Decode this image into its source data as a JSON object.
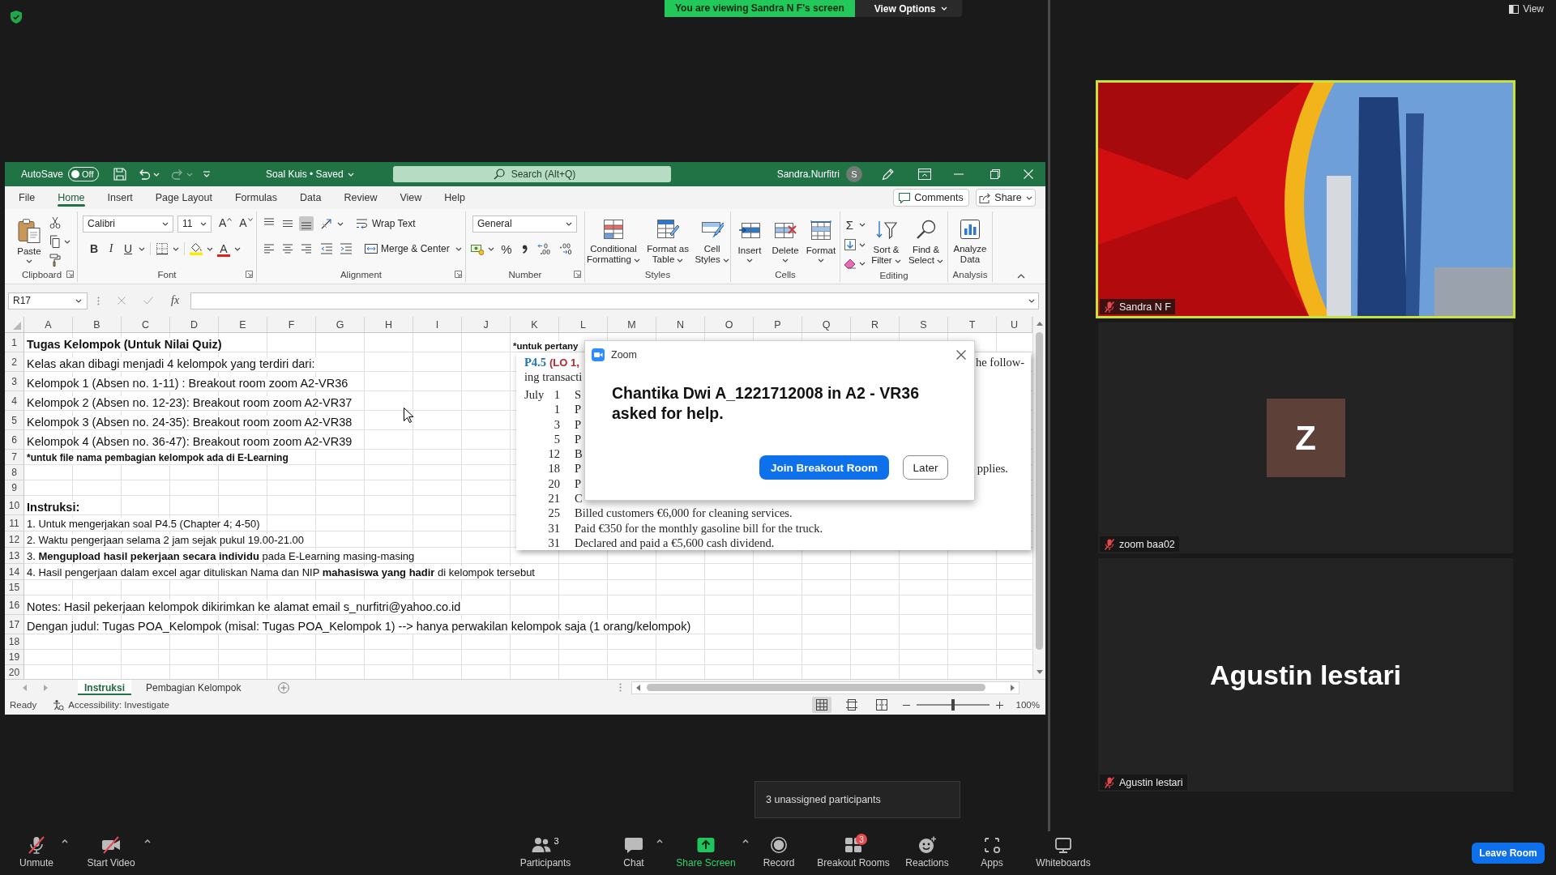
{
  "top_bar": {
    "viewing_banner": "You are viewing Sandra N F's screen",
    "view_options": "View Options"
  },
  "excel": {
    "title_bar": {
      "autosave": "AutoSave",
      "autosave_on": false,
      "autosave_state": "Off",
      "quick_access": [
        {
          "kind": "save",
          "disabled": false
        },
        {
          "kind": "undo",
          "disabled": false
        },
        {
          "kind": "redo",
          "disabled": true
        }
      ],
      "document": "Soal Kuis • Saved",
      "search": {
        "placeholder": "Search (Alt+Q)"
      },
      "user_name": "Sandra.Nurfitri",
      "user_initial": "S"
    },
    "tabs": [
      {
        "label": "File",
        "selected": false
      },
      {
        "label": "Home",
        "selected": true
      },
      {
        "label": "Insert",
        "selected": false
      },
      {
        "label": "Page Layout",
        "selected": false
      },
      {
        "label": "Formulas",
        "selected": false
      },
      {
        "label": "Data",
        "selected": false
      },
      {
        "label": "Review",
        "selected": false
      },
      {
        "label": "View",
        "selected": false
      },
      {
        "label": "Help",
        "selected": false
      }
    ],
    "comments_button": "Comments",
    "share_button": "Share",
    "ribbon": {
      "clipboard": {
        "label": "Clipboard",
        "paste": "Paste"
      },
      "font": {
        "label": "Font",
        "font_name": "Calibri",
        "font_size": "11",
        "grow_font": "A",
        "shrink_font": "A",
        "bold": "B",
        "italic": "I",
        "underline": "U",
        "font_color": "A"
      },
      "alignment": {
        "label": "Alignment",
        "vertical": [
          {
            "selected": false
          },
          {
            "selected": false
          },
          {
            "selected": true
          }
        ],
        "horizontal": [
          {
            "selected": false
          },
          {
            "selected": false
          },
          {
            "selected": false
          }
        ],
        "wrap_text": "Wrap Text",
        "merge_center": "Merge & Center"
      },
      "number": {
        "label": "Number",
        "format": "General",
        "percent": "%"
      },
      "styles": {
        "label": "Styles",
        "buttons": [
          "Conditional Formatting",
          "Format as Table",
          "Cell Styles"
        ]
      },
      "cells": {
        "label": "Cells",
        "buttons": [
          "Insert",
          "Delete",
          "Format"
        ]
      },
      "editing": {
        "label": "Editing",
        "autosum": "Σ",
        "buttons": [
          "Sort & Filter",
          "Find & Select"
        ]
      },
      "analysis": {
        "label": "Analysis",
        "buttons": [
          "Analyze Data"
        ]
      }
    },
    "formula_bar": {
      "name_box": "R17",
      "function_label": "fx"
    },
    "columns": [
      "A",
      "B",
      "C",
      "D",
      "E",
      "F",
      "G",
      "H",
      "I",
      "J",
      "K",
      "L",
      "M",
      "N",
      "O",
      "P",
      "Q",
      "R",
      "S",
      "T",
      "U"
    ],
    "rows": [
      {
        "number": "1",
        "kind": "title",
        "cell_a": "Tugas Kelompok (Untuk Nilai Quiz)",
        "cell_k": "*untuk pertany"
      },
      {
        "number": "2",
        "kind": "large",
        "cell_a": "Kelas akan dibagi menjadi 4 kelompok yang terdiri dari:"
      },
      {
        "number": "3",
        "kind": "large",
        "cell_a": "Kelompok 1 (Absen no. 1-11) : Breakout room zoom A2-VR36"
      },
      {
        "number": "4",
        "kind": "large",
        "cell_a": "Kelompok 2 (Absen no. 12-23): Breakout room zoom A2-VR37"
      },
      {
        "number": "5",
        "kind": "large",
        "cell_a": "Kelompok 3 (Absen no. 24-35): Breakout room zoom A2-VR38"
      },
      {
        "number": "6",
        "kind": "large",
        "cell_a": "Kelompok 4 (Absen no. 36-47): Breakout room zoom A2-VR39"
      },
      {
        "number": "7",
        "kind": "note",
        "cell_a": "*untuk file nama pembagian kelompok ada di E-Learning"
      },
      {
        "number": "8",
        "kind": "blank"
      },
      {
        "number": "9",
        "kind": "blank"
      },
      {
        "number": "10",
        "kind": "title",
        "cell_a": "Instruksi:"
      },
      {
        "number": "11",
        "kind": "item",
        "cell_a": "1. Untuk mengerjakan soal P4.5 (Chapter 4; 4-50)"
      },
      {
        "number": "12",
        "kind": "item",
        "cell_a": "2. Waktu pengerjaan selama 2 jam sejak pukul 19.00-21.00"
      },
      {
        "number": "13",
        "kind": "item",
        "cell_a": "3. **Mengupload hasil pekerjaan secara individu** pada E-Learning masing-masing"
      },
      {
        "number": "14",
        "kind": "item",
        "cell_a": "4. Hasil pengerjaan dalam excel agar dituliskan Nama dan NIP **mahasiswa yang hadir** di kelompok tersebut"
      },
      {
        "number": "15",
        "kind": "blank"
      },
      {
        "number": "16",
        "kind": "large",
        "cell_a": "Notes: Hasil pekerjaan kelompok dikirimkan ke alamat email s_nurfitri@yahoo.co.id"
      },
      {
        "number": "17",
        "kind": "large",
        "cell_a": "Dengan judul: Tugas POA_Kelompok (misal: Tugas POA_Kelompok 1) --> hanya perwakilan kelompok saja (1 orang/kelompok)"
      },
      {
        "number": "18",
        "kind": "blank"
      },
      {
        "number": "19",
        "kind": "blank"
      },
      {
        "number": "20",
        "kind": "blank"
      }
    ],
    "sheet_tabs": [
      {
        "label": "Instruksi",
        "selected": true
      },
      {
        "label": "Pembagian Kelompok",
        "selected": false
      }
    ],
    "status_bar": {
      "status": "Ready",
      "accessibility": "Accessibility: Investigate",
      "views": [
        {
          "selected": true
        },
        {
          "selected": false
        },
        {
          "selected": false
        }
      ],
      "zoom_slider": {
        "level": 0.5
      },
      "zoom": "100%"
    }
  },
  "pasted_image": {
    "problem": "P4.5",
    "objectives": "(LO 1,",
    "intro_end": "he follow-",
    "intro_line2": "ing transacti",
    "transactions": [
      {
        "month": "July",
        "day": "1",
        "text": "S"
      },
      {
        "day": "1",
        "text": "P"
      },
      {
        "day": "3",
        "text": "P"
      },
      {
        "day": "5",
        "text": "P"
      },
      {
        "day": "12",
        "text": "B"
      },
      {
        "day": "18",
        "text": "P",
        "tail": "pplies."
      },
      {
        "day": "20",
        "text": "P"
      },
      {
        "day": "21",
        "text": "C"
      },
      {
        "day": "25",
        "text": "Billed customers €6,000 for cleaning services."
      },
      {
        "day": "31",
        "text": "Paid €350 for the monthly gasoline bill for the truck."
      },
      {
        "day": "31",
        "text": "Declared and paid a €5,600 cash dividend."
      }
    ]
  },
  "dialog": {
    "app_name": "Zoom",
    "message": "Chantika Dwi A_1221712008 in A2 - VR36 asked for help.",
    "buttons": [
      {
        "label": "Join Breakout Room",
        "kind": "primary"
      },
      {
        "label": "Later",
        "kind": "secondary"
      }
    ]
  },
  "gallery": {
    "view_button": "View",
    "tiles": [
      {
        "kind": "video",
        "name": "Sandra N F",
        "muted": true,
        "active_speaker": true
      },
      {
        "kind": "avatar",
        "initial": "Z",
        "name": "zoom baa02",
        "muted": true,
        "active_speaker": false
      },
      {
        "kind": "name",
        "display_name": "Agustin lestari",
        "name": "Agustin lestari",
        "muted": true,
        "active_speaker": false
      }
    ]
  },
  "toolbar": {
    "items": [
      {
        "kind": "audio",
        "label": "Unmute",
        "off": true,
        "caret": true
      },
      {
        "kind": "video",
        "label": "Start Video",
        "off": true,
        "caret": true
      },
      {
        "kind": "participants",
        "label": "Participants",
        "count": "3",
        "off": false,
        "caret": false
      },
      {
        "kind": "chat",
        "label": "Chat",
        "off": false,
        "caret": true
      },
      {
        "kind": "share",
        "label": "Share Screen",
        "off": false,
        "caret": true
      },
      {
        "kind": "record",
        "label": "Record",
        "off": false,
        "caret": false
      },
      {
        "kind": "breakout",
        "label": "Breakout Rooms",
        "badge": "3",
        "off": false,
        "caret": false
      },
      {
        "kind": "reactions",
        "label": "Reactions",
        "off": false,
        "caret": false
      },
      {
        "kind": "apps",
        "label": "Apps",
        "off": false,
        "caret": false
      },
      {
        "kind": "whiteboards",
        "label": "Whiteboards",
        "off": false,
        "caret": false
      }
    ],
    "leave_button": "Leave Room",
    "tooltip": "3 unassigned participants"
  }
}
